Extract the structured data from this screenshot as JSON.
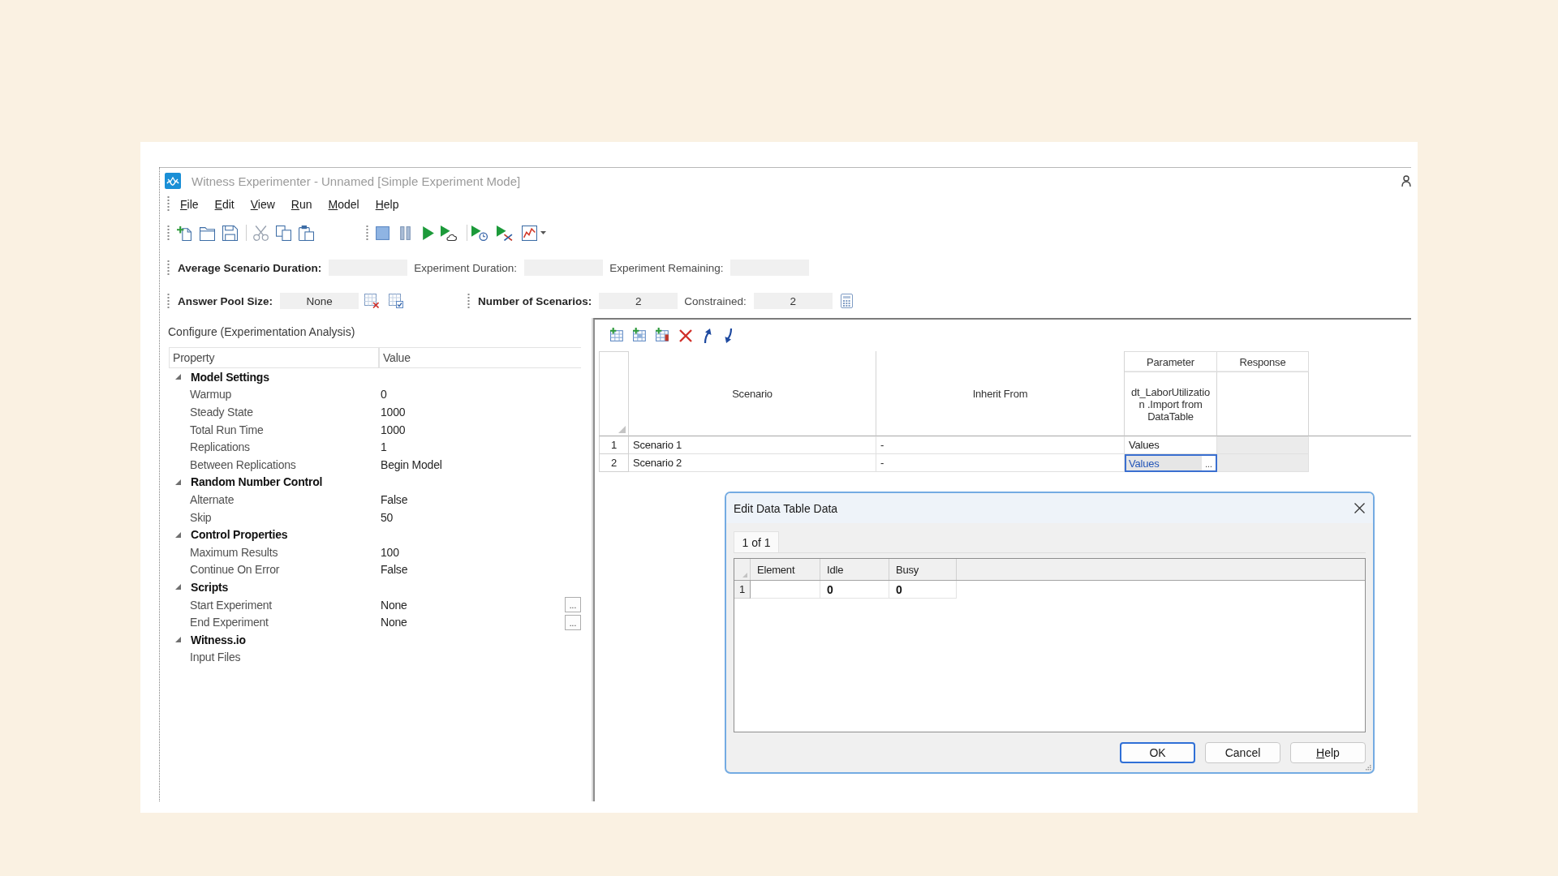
{
  "window": {
    "title": "Witness Experimenter - Unnamed [Simple Experiment Mode]"
  },
  "menu": [
    "File",
    "Edit",
    "View",
    "Run",
    "Model",
    "Help"
  ],
  "timing_bar": [
    {
      "label": "Average Scenario Duration:"
    },
    {
      "label": "Experiment Duration:"
    },
    {
      "label": "Experiment Remaining:"
    }
  ],
  "pool_bar": [
    {
      "label": "Answer Pool Size:",
      "value": "None"
    }
  ],
  "scenario_bar": [
    {
      "label": "Number of Scenarios:",
      "value": "2"
    },
    {
      "label": "Constrained:",
      "value": "2"
    }
  ],
  "configure": {
    "title": "Configure (Experimentation Analysis)",
    "columns": [
      "Property",
      "Value"
    ],
    "categories": [
      {
        "name": "Model Settings",
        "expanded": true,
        "properties": [
          {
            "name": "Warmup",
            "value": "0"
          },
          {
            "name": "Steady State",
            "value": "1000"
          },
          {
            "name": "Total Run Time",
            "value": "1000"
          },
          {
            "name": "Replications",
            "value": "1"
          },
          {
            "name": "Between Replications",
            "value": "Begin Model"
          }
        ]
      },
      {
        "name": "Random Number Control",
        "expanded": true,
        "properties": [
          {
            "name": "Alternate",
            "value": "False"
          },
          {
            "name": "Skip",
            "value": "50"
          }
        ]
      },
      {
        "name": "Control Properties",
        "expanded": true,
        "properties": [
          {
            "name": "Maximum Results",
            "value": "100"
          },
          {
            "name": "Continue On Error",
            "value": "False"
          }
        ]
      },
      {
        "name": "Scripts",
        "expanded": true,
        "properties": [
          {
            "name": "Start Experiment",
            "value": "None",
            "button": "..."
          },
          {
            "name": "End Experiment",
            "value": "None",
            "button": "..."
          }
        ]
      },
      {
        "name": "Witness.io",
        "expanded": true,
        "properties": [
          {
            "name": "Input Files"
          }
        ]
      }
    ]
  },
  "scenarios": {
    "columns": [
      "Scenario",
      "Inherit From"
    ],
    "parameter_group": {
      "label": "Parameter",
      "columns": [
        "dt_LaborUtilization .Import from DataTable"
      ]
    },
    "response_group": {
      "label": "Response"
    },
    "rows": [
      {
        "number": "1",
        "scenario": "Scenario 1",
        "inherit_from": "-",
        "parameter": "Values",
        "editing": false
      },
      {
        "number": "2",
        "scenario": "Scenario 2",
        "inherit_from": "-",
        "parameter": "Values",
        "editing": true,
        "button": "..."
      }
    ]
  },
  "dialog": {
    "title": "Edit Data Table Data",
    "tabs": [
      {
        "label": "1 of 1",
        "selected": true
      }
    ],
    "table": {
      "columns": [
        "Element",
        "Idle",
        "Busy"
      ],
      "rows": [
        {
          "number": "1",
          "cells": [
            {},
            {
              "text": "0"
            },
            {
              "text": "0"
            }
          ]
        }
      ]
    },
    "buttons": [
      {
        "label": "OK",
        "default": true,
        "mnemonic": false
      },
      {
        "label": "Cancel",
        "default": false,
        "mnemonic": false
      },
      {
        "label": "Help",
        "default": false,
        "mnemonic": true
      }
    ]
  }
}
